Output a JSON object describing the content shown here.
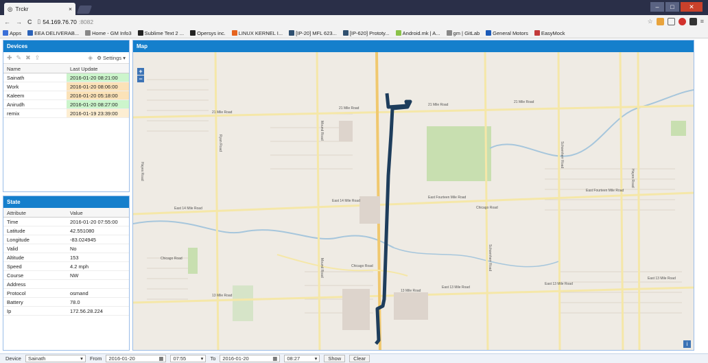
{
  "browser": {
    "tab_title": "Trckr",
    "tab_close": "×",
    "url_host": "54.169.76.70",
    "url_port": ":8082",
    "bookmarks": [
      {
        "label": "Apps",
        "color": "#3a6fd8"
      },
      {
        "label": "EEA DELIVERAB...",
        "color": "#2a62b8"
      },
      {
        "label": "Home - GM Info3",
        "color": "#888888"
      },
      {
        "label": "Sublime Text 2 ...",
        "color": "#222222"
      },
      {
        "label": "Opersys inc.",
        "color": "#222222"
      },
      {
        "label": "LINUX KERNEL I...",
        "color": "#e6641e"
      },
      {
        "label": "[IP-20] MFL 623...",
        "color": "#305070"
      },
      {
        "label": "[IP-620] Prototy...",
        "color": "#305070"
      },
      {
        "label": "Android.mk | A...",
        "color": "#8ac249"
      },
      {
        "label": "gm | GitLab",
        "color": "#888888"
      },
      {
        "label": "General Motors",
        "color": "#1b5ab8"
      },
      {
        "label": "EasyMock",
        "color": "#c23a3a"
      }
    ]
  },
  "devices": {
    "title": "Devices",
    "settings_label": "Settings",
    "columns": {
      "name": "Name",
      "last_update": "Last Update"
    },
    "rows": [
      {
        "name": "Sainath",
        "last_update": "2016-01-20 08:21:00",
        "status": "green"
      },
      {
        "name": "Work",
        "last_update": "2016-01-20 08:06:00",
        "status": "orange"
      },
      {
        "name": "Kaleem",
        "last_update": "2016-01-20 05:18:00",
        "status": "orange"
      },
      {
        "name": "Anirudh",
        "last_update": "2016-01-20 08:27:00",
        "status": "green"
      },
      {
        "name": "remix",
        "last_update": "2016-01-19 23:39:00",
        "status": "yellow"
      }
    ]
  },
  "state": {
    "title": "State",
    "columns": {
      "attribute": "Attribute",
      "value": "Value"
    },
    "rows": [
      {
        "attribute": "Time",
        "value": "2016-01-20 07:55:00"
      },
      {
        "attribute": "Latitude",
        "value": "42.551080"
      },
      {
        "attribute": "Longitude",
        "value": "-83.024945"
      },
      {
        "attribute": "Valid",
        "value": "No"
      },
      {
        "attribute": "Altitude",
        "value": "153"
      },
      {
        "attribute": "Speed",
        "value": "4.2 mph"
      },
      {
        "attribute": "Course",
        "value": "NW"
      },
      {
        "attribute": "Address",
        "value": ""
      },
      {
        "attribute": "Protocol",
        "value": "osmand"
      },
      {
        "attribute": "Battery",
        "value": "78.0"
      },
      {
        "attribute": "Ip",
        "value": "172.56.28.224"
      }
    ]
  },
  "map": {
    "title": "Map",
    "zoom_in": "+",
    "zoom_out": "−",
    "info": "i",
    "road_labels": {
      "r21": "21 Mile Road",
      "r14a": "East 14 Mile Road",
      "r14b": "East Fourteen Mile Road",
      "r13": "13 Mile Road",
      "r13b": "East 13 Mile Road",
      "chicago": "Chicago Road",
      "hayes": "Hayes Road",
      "ryan": "Ryan Road",
      "mound": "Mound Road",
      "schoenherr": "Schoenherr Road"
    }
  },
  "bottom": {
    "device_label": "Device",
    "device_value": "Sainath",
    "from_label": "From",
    "from_date": "2016-01-20",
    "from_time": "07:55",
    "to_label": "To",
    "to_date": "2016-01-20",
    "to_time": "08:27",
    "show_label": "Show",
    "clear_label": "Clear"
  }
}
